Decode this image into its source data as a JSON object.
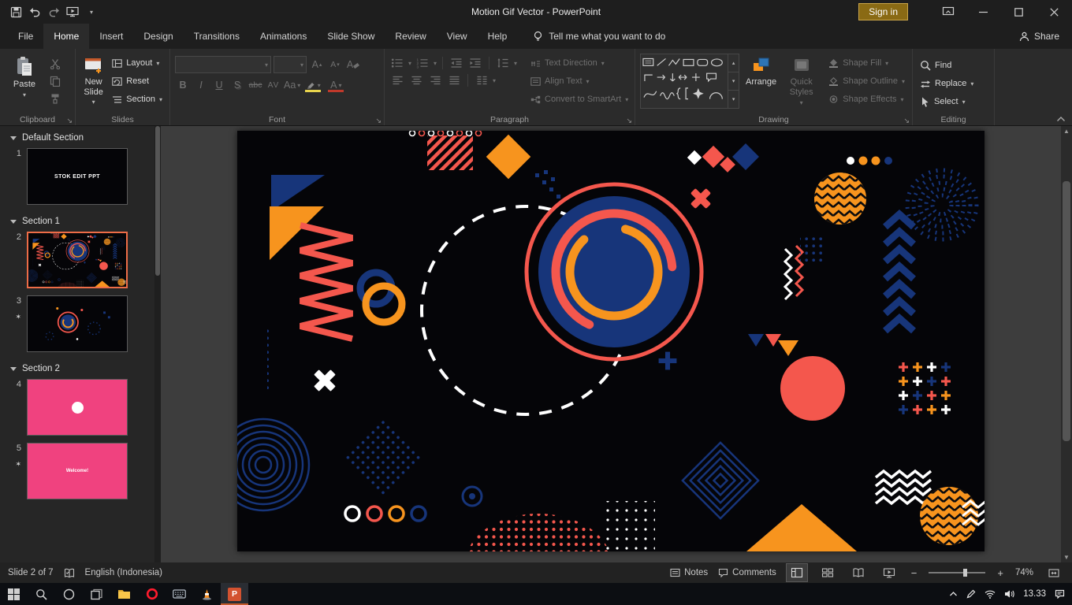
{
  "colors": {
    "coral": "#f4574d",
    "orange": "#f7941e",
    "navy": "#17357a",
    "pink": "#f0427f",
    "sel": "#ed6c47",
    "accent": "#c55a2b"
  },
  "titlebar": {
    "title": "Motion Gif Vector - PowerPoint",
    "sign_in": "Sign in"
  },
  "tabs": [
    "File",
    "Home",
    "Insert",
    "Design",
    "Transitions",
    "Animations",
    "Slide Show",
    "Review",
    "View",
    "Help"
  ],
  "tell_me": "Tell me what you want to do",
  "share_label": "Share",
  "ribbon": {
    "clipboard": {
      "group_label": "Clipboard",
      "paste": "Paste"
    },
    "slides": {
      "group_label": "Slides",
      "new_slide": "New Slide",
      "layout": "Layout",
      "reset": "Reset",
      "section": "Section"
    },
    "font": {
      "group_label": "Font",
      "bold": "B",
      "italic": "I",
      "underline": "U",
      "shadow": "S",
      "strikethrough": "abc",
      "char_spacing": "AV",
      "change_case": "Aa",
      "grow_font": "A",
      "shrink_font": "A",
      "clear_format": "A",
      "font_color": "A"
    },
    "paragraph": {
      "group_label": "Paragraph",
      "text_direction": "Text Direction",
      "align_text": "Align Text",
      "convert_smartart": "Convert to SmartArt"
    },
    "drawing": {
      "group_label": "Drawing",
      "arrange": "Arrange",
      "quick_styles": "Quick Styles",
      "shape_fill": "Shape Fill",
      "shape_outline": "Shape Outline",
      "shape_effects": "Shape Effects"
    },
    "editing": {
      "group_label": "Editing",
      "find": "Find",
      "replace": "Replace",
      "select": "Select"
    }
  },
  "slides_panel": {
    "sections": [
      {
        "name": "Default Section"
      },
      {
        "name": "Section 1"
      },
      {
        "name": "Section 2"
      }
    ],
    "slides": [
      {
        "num": "1",
        "label": "STOK EDIT PPT"
      },
      {
        "num": "2"
      },
      {
        "num": "3"
      },
      {
        "num": "4"
      },
      {
        "num": "5",
        "label": "Welcome!"
      }
    ],
    "star": "✶"
  },
  "statusbar": {
    "slide_info": "Slide 2 of 7",
    "language": "English (Indonesia)",
    "notes": "Notes",
    "comments": "Comments",
    "zoom_level": "74%"
  },
  "taskbar": {
    "time": "13.33"
  }
}
